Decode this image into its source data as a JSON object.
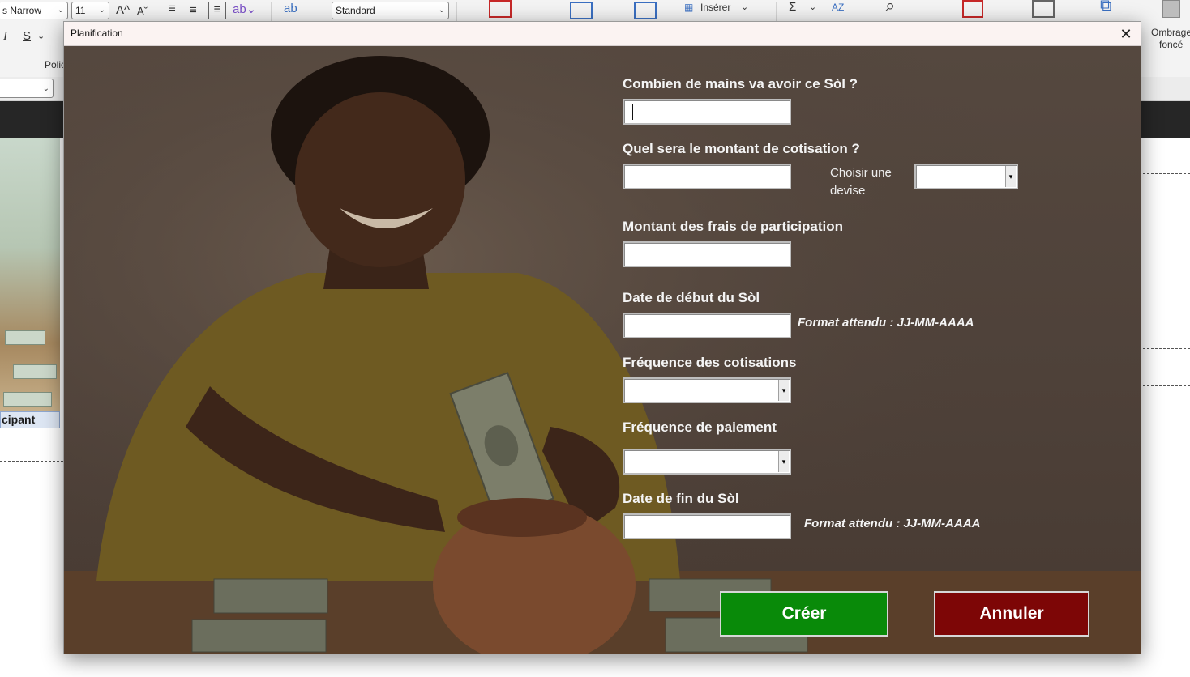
{
  "excel": {
    "font_name": "s Narrow",
    "font_size": "11",
    "number_format": "Standard",
    "insert_label": "Insérer",
    "police_group": "Polic",
    "shading_label_1": "Ombrage",
    "shading_label_2": "foncé",
    "italic": "I",
    "strike": "S",
    "grow_font": "A^",
    "shrink_font": "Aˇ",
    "sum": "Σ",
    "sort": "AZ",
    "cell_text": "cipant"
  },
  "dialog": {
    "title": "Planification",
    "close_glyph": "✕",
    "fields": {
      "hands_label": "Combien de mains va avoir ce Sòl ?",
      "amount_label": "Quel sera le montant de cotisation ?",
      "currency_label": "Choisir une devise",
      "fee_label": "Montant des frais de participation",
      "start_label": "Date de début du Sòl",
      "start_hint": "Format attendu : JJ-MM-AAAA",
      "frequency_label": "Fréquence des cotisations",
      "payment_label": "Fréquence de paiement",
      "end_label": "Date de fin du Sòl",
      "end_hint": "Format attendu : JJ-MM-AAAA"
    },
    "values": {
      "hands": "",
      "amount": "",
      "currency": "",
      "fee": "",
      "start": "",
      "frequency": "",
      "payment": "",
      "end": ""
    },
    "combo_arrow": "▾",
    "buttons": {
      "create": "Créer",
      "cancel": "Annuler"
    }
  },
  "colors": {
    "create": "#098a09",
    "cancel": "#7d0606",
    "overlay": "#4c3e36"
  }
}
